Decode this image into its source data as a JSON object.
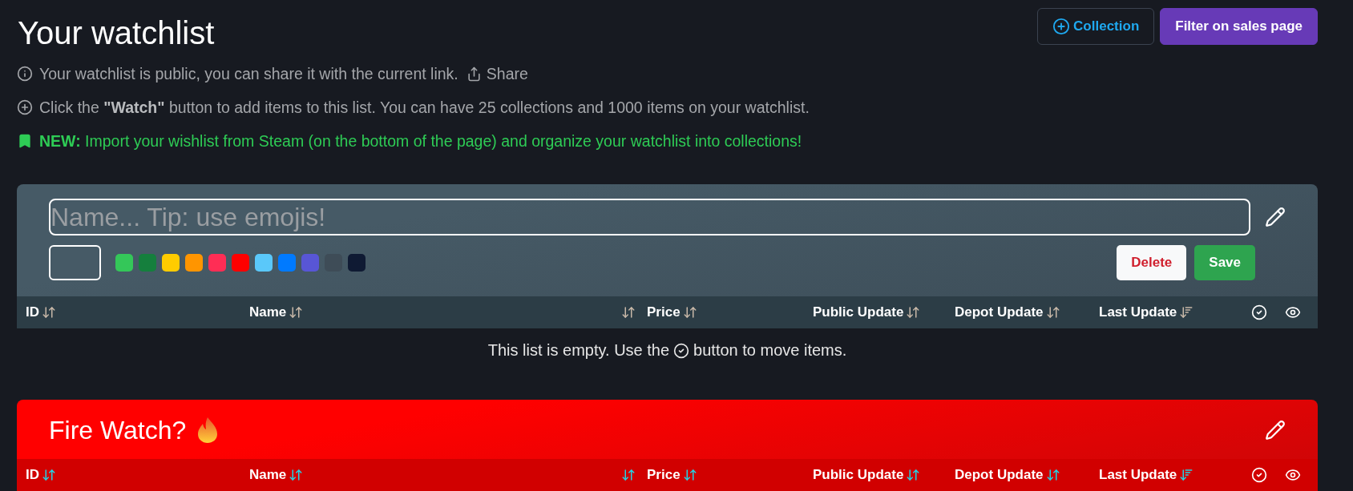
{
  "title": "Your watchlist",
  "header_buttons": [
    {
      "kind": "add",
      "label": "Collection"
    },
    {
      "kind": "primary",
      "label": "Filter on sales page"
    }
  ],
  "notices": [
    {
      "kind": "info",
      "text": "Your watchlist is public, you can share it with the current link.",
      "link": "Share"
    },
    {
      "kind": "add",
      "text": "Click the **\"Watch\"** button to add items to this list. You can have 25 collections and 1000 items on your watchlist."
    },
    {
      "kind": "new",
      "text": "**NEW:** Import your wishlist from Steam (on the bottom of the page) and organize your watchlist into collections!"
    }
  ],
  "collections": [
    {
      "editing": true,
      "color": "#465a66",
      "placeholder": "Name... Tip: use emojis!",
      "swatches": [
        {
          "color": "#34c759"
        },
        {
          "color": "#157f3d"
        },
        {
          "color": "#ffcc00"
        },
        {
          "color": "#ff9500"
        },
        {
          "color": "#ff2d55"
        },
        {
          "color": "#ff0000"
        },
        {
          "color": "#5ac8fa"
        },
        {
          "color": "#007aff"
        },
        {
          "color": "#5856d6"
        },
        {
          "color": "#3e4c57"
        },
        {
          "color": "#0f1a33"
        }
      ],
      "buttons": [
        {
          "kind": "delete",
          "label": "Delete"
        },
        {
          "kind": "save",
          "label": "Save"
        }
      ],
      "columns": [
        {
          "kind": "text",
          "label": "ID",
          "sorted_desc": false
        },
        {
          "kind": "text",
          "label": "Name",
          "sorted_desc": false
        },
        {
          "kind": "text",
          "sorted_desc": false
        },
        {
          "kind": "text",
          "label": "Price",
          "sorted_desc": false
        },
        {
          "kind": "text",
          "label": "Public Update",
          "sorted_desc": false
        },
        {
          "kind": "text",
          "label": "Depot Update",
          "sorted_desc": false
        },
        {
          "kind": "text",
          "label": "Last Update",
          "sorted_desc": true
        },
        {
          "kind": "check"
        },
        {
          "kind": "eye"
        }
      ],
      "empty_text": "This list is empty. Use the",
      "empty_text_end": "button to move items."
    },
    {
      "editing": false,
      "color": "#ff0000",
      "name": "Fire Watch?",
      "columns": [
        {
          "kind": "text",
          "label": "ID",
          "sorted_desc": false
        },
        {
          "kind": "text",
          "label": "Name",
          "sorted_desc": false
        },
        {
          "kind": "text",
          "sorted_desc": false
        },
        {
          "kind": "text",
          "label": "Price",
          "sorted_desc": false
        },
        {
          "kind": "text",
          "label": "Public Update",
          "sorted_desc": false
        },
        {
          "kind": "text",
          "label": "Depot Update",
          "sorted_desc": false
        },
        {
          "kind": "text",
          "label": "Last Update",
          "sorted_desc": true
        },
        {
          "kind": "check"
        },
        {
          "kind": "eye"
        }
      ]
    }
  ]
}
